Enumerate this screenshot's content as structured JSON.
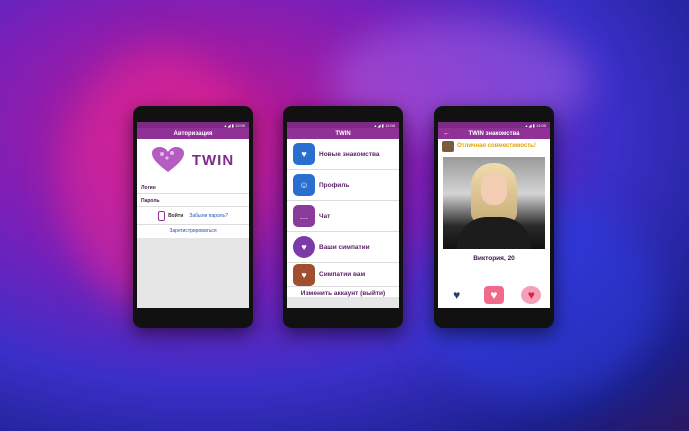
{
  "phone1": {
    "status": "▴ ◢ ▮ 12:00",
    "title": "Авторизация",
    "logo_text": "TWIN",
    "login_label": "Логин",
    "password_label": "Пароль",
    "login_button": "Войти",
    "forgot_link": "Забыли пароль?",
    "register_link": "Зарегистрироваться"
  },
  "phone2": {
    "status": "▴ ◢ ▮ 12:00",
    "title": "TWIN",
    "menu": [
      {
        "label": "Новые знакомства",
        "icon": "new-matches-icon",
        "glyph": "♥",
        "color": "#2a6fd0"
      },
      {
        "label": "Профиль",
        "icon": "profile-icon",
        "glyph": "☺",
        "color": "#2a6fd0"
      },
      {
        "label": "Чат",
        "icon": "chat-icon",
        "glyph": "…",
        "color": "#8a3a9a"
      },
      {
        "label": "Ваши симпатии",
        "icon": "your-likes-icon",
        "glyph": "♥",
        "color": "#7a3aa8"
      },
      {
        "label": "Симпатии вам",
        "icon": "likes-you-icon",
        "glyph": "♥",
        "color": "#a05030"
      }
    ],
    "logout": "Изменить аккаунт (выйти)"
  },
  "phone3": {
    "status": "▴ ◢ ▮ 12:00",
    "back": "←",
    "title": "TWIN знакомства",
    "match_text": "Отличная совместимость!",
    "profile_name": "Виктория, 20",
    "actions": {
      "dislike": "♥",
      "message": "♥",
      "like": "♥"
    }
  },
  "colors": {
    "primary": "#8f3197",
    "accent": "#e0a400",
    "link": "#2a4fb0"
  }
}
